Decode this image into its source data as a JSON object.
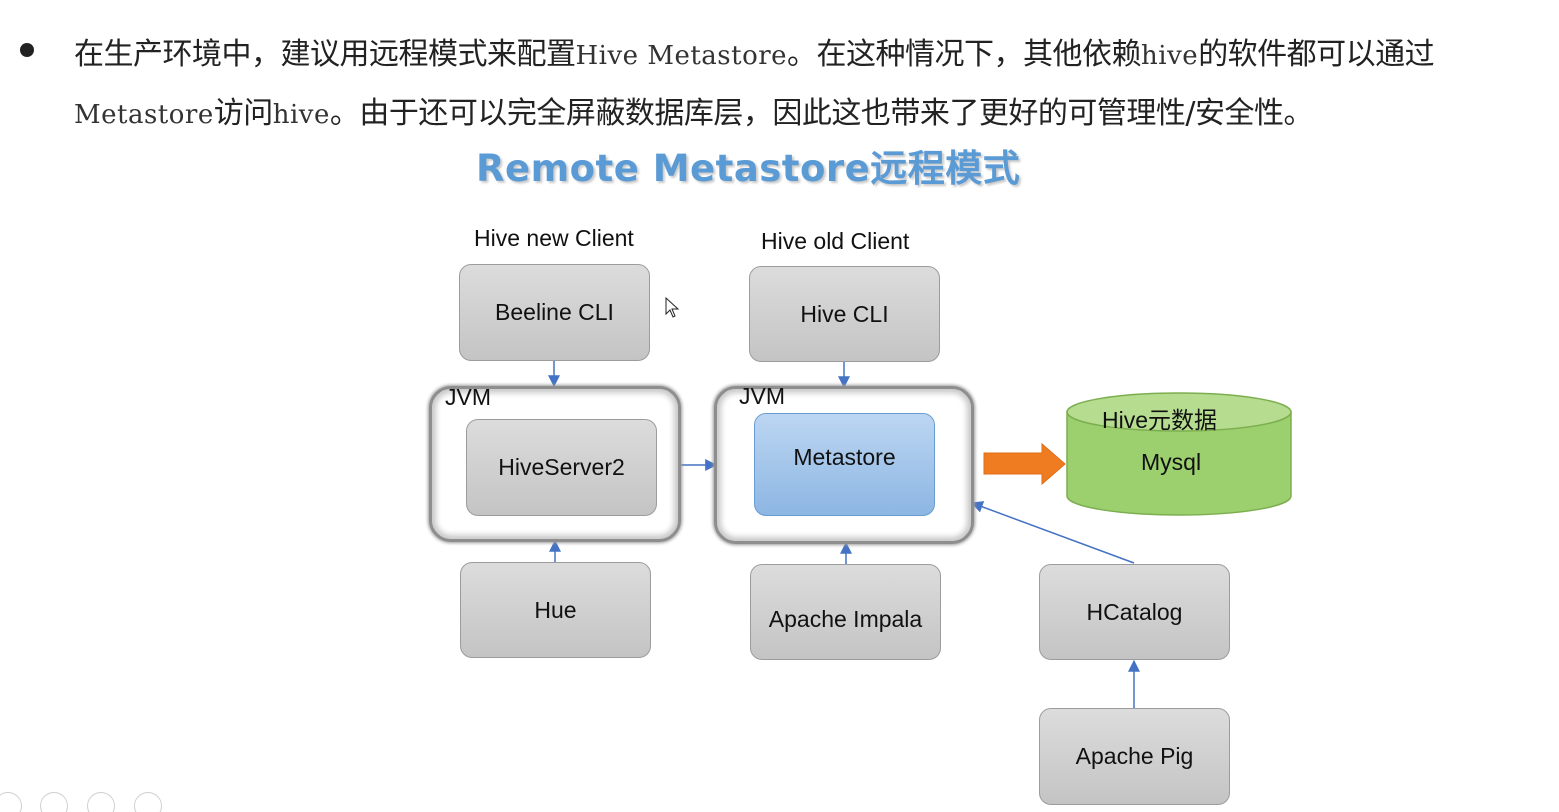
{
  "paragraph": {
    "seg1": "在生产环境中，建议用远程模式来配置",
    "code1": "Hive Metastore",
    "seg2": "。在这种情况下，其他依赖",
    "code2": "hive",
    "seg3": "的软件都可以通过",
    "code3": "Metastore",
    "seg4": "访问",
    "code4": "hive",
    "seg5": "。由于还可以完全屏蔽数据库层，因此这也带来了更好的可管理性/安全性。"
  },
  "diagram": {
    "title": "Remote Metastore远程模式",
    "new_client_caption": "Hive new Client",
    "old_client_caption": "Hive old Client",
    "beeline": "Beeline CLI",
    "hive_cli": "Hive CLI",
    "jvm_left": "JVM",
    "jvm_right": "JVM",
    "hiveserver2": "HiveServer2",
    "metastore": "Metastore",
    "db_caption": "Hive元数据",
    "db_name": "Mysql",
    "hue": "Hue",
    "impala": "Apache Impala",
    "hcatalog": "HCatalog",
    "pig": "Apache Pig"
  },
  "colors": {
    "accent_blue": "#5b9bd5",
    "arrow_orange": "#f07c22",
    "db_green": "#9ccf6e",
    "connector_blue": "#4472c4"
  },
  "toolbar": {
    "icons": [
      "pen-icon",
      "slides-icon",
      "zoom-icon",
      "more-icon"
    ]
  }
}
